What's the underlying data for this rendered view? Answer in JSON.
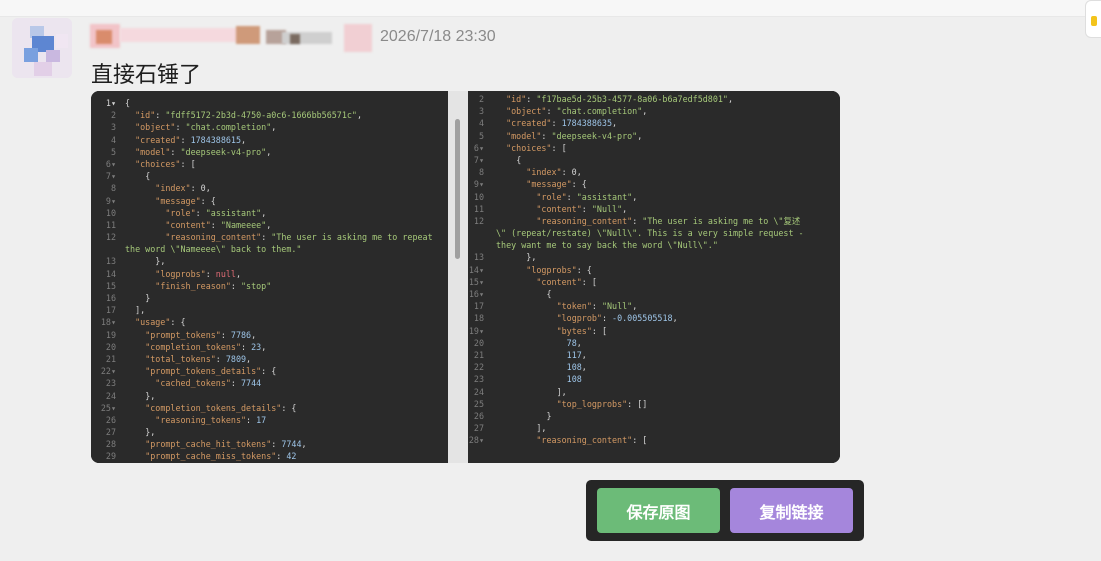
{
  "message": {
    "timestamp": "2026/7/18 23:30",
    "text": "直接石锤了"
  },
  "screenshot": {
    "left_code": [
      "{",
      "  \"id\": \"fdff5172-2b3d-4750-a0c6-1666bb56571c\",",
      "  \"object\": \"chat.completion\",",
      "  \"created\": 1784388615,",
      "  \"model\": \"deepseek-v4-pro\",",
      "  \"choices\": [",
      "    {",
      "      \"index\": 0,",
      "      \"message\": {",
      "        \"role\": \"assistant\",",
      "        \"content\": \"Nameeee\",",
      "        \"reasoning_content\": \"The user is asking me to repeat",
      "the word \\\"Nameeee\\\" back to them.\"",
      "      },",
      "      \"logprobs\": null,",
      "      \"finish_reason\": \"stop\"",
      "    }",
      "  ],",
      "  \"usage\": {",
      "    \"prompt_tokens\": 7786,",
      "    \"completion_tokens\": 23,",
      "    \"total_tokens\": 7809,",
      "    \"prompt_tokens_details\": {",
      "      \"cached_tokens\": 7744",
      "    },",
      "    \"completion_tokens_details\": {",
      "      \"reasoning_tokens\": 17",
      "    },",
      "    \"prompt_cache_hit_tokens\": 7744,",
      "    \"prompt_cache_miss_tokens\": 42",
      "  },"
    ],
    "left_lines": [
      "1▾",
      "2",
      "3",
      "4",
      "5",
      "6▾",
      "7▾",
      "8",
      "9▾",
      "10",
      "11",
      "12",
      "",
      "13",
      "14",
      "15",
      "16",
      "17",
      "18▾",
      "19",
      "20",
      "21",
      "22▾",
      "23",
      "24",
      "25▾",
      "26",
      "27",
      "28",
      "29",
      "30"
    ],
    "right_code": [
      "  \"id\": \"f17bae5d-25b3-4577-8a06-b6a7edf5d801\",",
      "  \"object\": \"chat.completion\",",
      "  \"created\": 1784388635,",
      "  \"model\": \"deepseek-v4-pro\",",
      "  \"choices\": [",
      "    {",
      "      \"index\": 0,",
      "      \"message\": {",
      "        \"role\": \"assistant\",",
      "        \"content\": \"Null\",",
      "        \"reasoning_content\": \"The user is asking me to \\\"复述",
      "\\\" (repeat/restate) \\\"Null\\\". This is a very simple request -",
      "they want me to say back the word \\\"Null\\\".\"",
      "      },",
      "      \"logprobs\": {",
      "        \"content\": [",
      "          {",
      "            \"token\": \"Null\",",
      "            \"logprob\": -0.005505518,",
      "            \"bytes\": [",
      "              78,",
      "              117,",
      "              108,",
      "              108",
      "            ],",
      "            \"top_logprobs\": []",
      "          }",
      "        ],",
      "        \"reasoning_content\": ["
    ],
    "right_lines": [
      "2",
      "3",
      "4",
      "5",
      "6▾",
      "7▾",
      "8",
      "9▾",
      "10",
      "11",
      "12",
      "",
      "",
      "13",
      "14▾",
      "15▾",
      "16▾",
      "17",
      "18",
      "19▾",
      "20",
      "21",
      "22",
      "23",
      "24",
      "25",
      "26",
      "27",
      "28▾"
    ]
  },
  "actions": {
    "save_label": "保存原图",
    "copy_label": "复制链接"
  },
  "colors": {
    "save_button": "#6cbb78",
    "copy_button": "#a586dc",
    "code_key": "#d49a64",
    "code_string": "#a6c97a",
    "code_number": "#9ec5e8",
    "code_null": "#e06c75",
    "code_punct": "#d4d4d4"
  }
}
